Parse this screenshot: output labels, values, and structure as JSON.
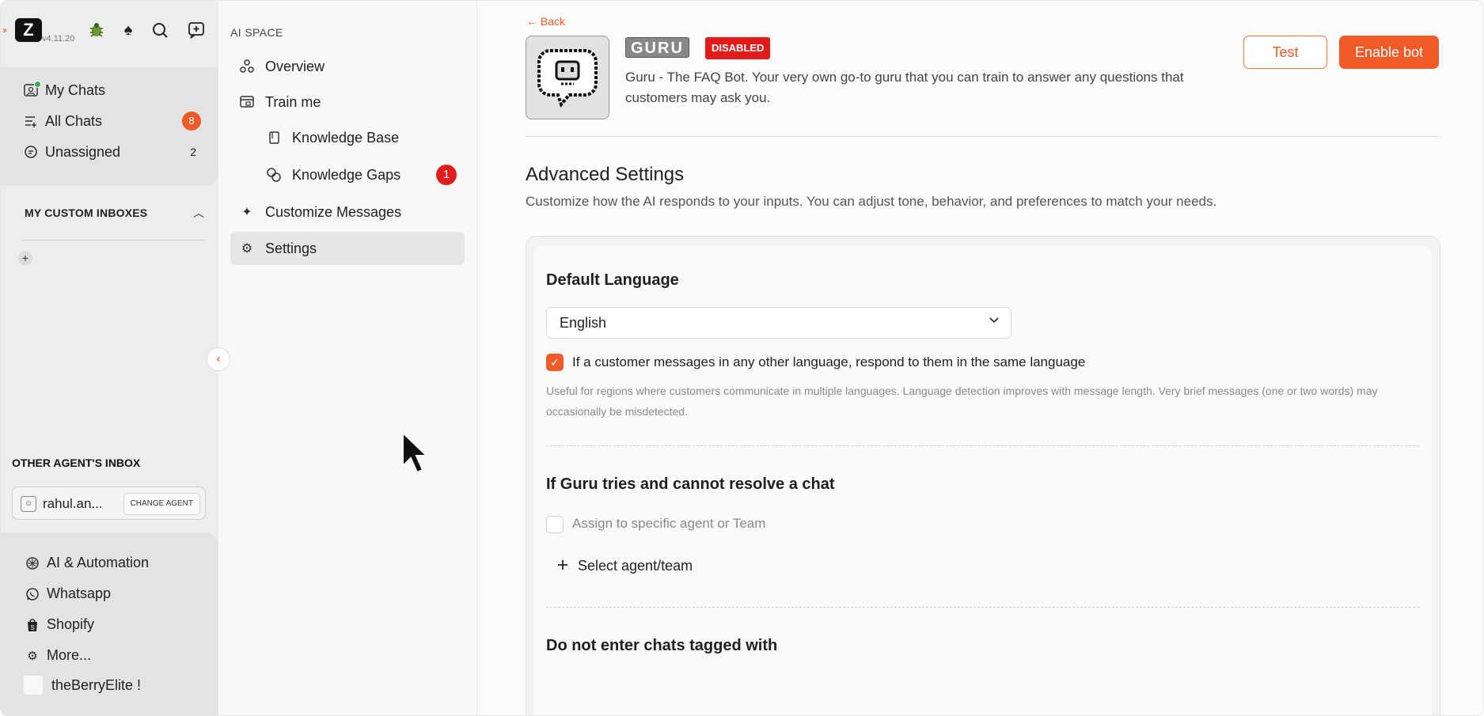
{
  "app": {
    "version": "v4.11.20",
    "logo_letter": "Z"
  },
  "sidebar": {
    "primary": [
      {
        "label": "My Chats",
        "icon": "inbox-icon"
      },
      {
        "label": "All Chats",
        "icon": "list-icon",
        "badge": "8"
      },
      {
        "label": "Unassigned",
        "icon": "chat-icon",
        "count": "2"
      }
    ],
    "custom_inboxes_title": "MY CUSTOM INBOXES",
    "other_agent_title": "OTHER AGENT'S INBOX",
    "agent": {
      "name": "rahul.an...",
      "change_label": "CHANGE AGENT"
    },
    "bottom": [
      {
        "label": "AI & Automation",
        "icon": "ai-icon"
      },
      {
        "label": "Whatsapp",
        "icon": "whatsapp-icon"
      },
      {
        "label": "Shopify",
        "icon": "shopify-icon"
      },
      {
        "label": "More...",
        "icon": "gear-icon"
      }
    ],
    "user": {
      "name": "theBerryElite !"
    }
  },
  "ai_space": {
    "label": "AI SPACE",
    "items": [
      {
        "label": "Overview"
      },
      {
        "label": "Train me"
      },
      {
        "label": "Knowledge Base"
      },
      {
        "label": "Knowledge Gaps",
        "badge": "1"
      },
      {
        "label": "Customize Messages"
      },
      {
        "label": "Settings",
        "active": true
      }
    ]
  },
  "main": {
    "back_label": "Back",
    "bot": {
      "name": "GURU",
      "status": "DISABLED",
      "description": "Guru - The FAQ Bot. Your very own go-to guru that you can train to answer any questions that customers may ask you."
    },
    "buttons": {
      "test": "Test",
      "enable": "Enable bot"
    },
    "advanced": {
      "title": "Advanced Settings",
      "subtitle": "Customize how the AI responds to your inputs. You can adjust tone, behavior, and preferences to match your needs."
    },
    "default_language": {
      "title": "Default Language",
      "selected": "English",
      "same_language_label": "If a customer messages in any other language, respond to them in the same language",
      "helper": "Useful for regions where customers communicate in multiple languages. Language detection improves with message length. Very brief messages (one or two words) may occasionally be misdetected."
    },
    "cannot_resolve": {
      "title": "If Guru tries and cannot resolve a chat",
      "assign_label": "Assign to specific agent or Team",
      "select_label": "Select agent/team"
    },
    "tagged": {
      "title": "Do not enter chats tagged with"
    }
  },
  "colors": {
    "accent": "#f05a28",
    "danger": "#e11d1d"
  }
}
